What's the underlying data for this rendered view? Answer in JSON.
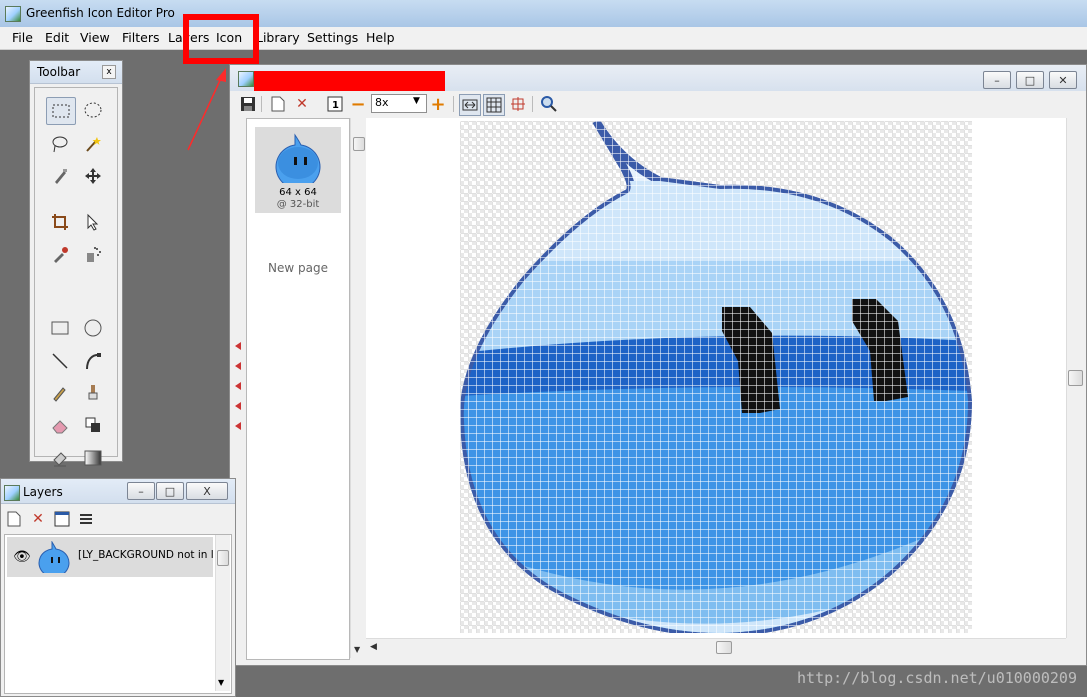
{
  "window": {
    "title": "Greenfish Icon Editor Pro"
  },
  "menu": [
    "File",
    "Edit",
    "View",
    "Filters",
    "Layers",
    "Icon",
    "Library",
    "Settings",
    "Help"
  ],
  "toolbar_panel": {
    "title": "Toolbar",
    "close": "x",
    "tools": [
      "rect-select",
      "ellipse-select",
      "lasso",
      "magic-wand",
      "picker-pen",
      "move",
      "crop",
      "pointer",
      "eyedropper",
      "spray",
      "rectangle",
      "ellipse",
      "line",
      "curve",
      "pencil",
      "brush",
      "eraser",
      "clone",
      "stamp",
      "gradient"
    ]
  },
  "layers_panel": {
    "title": "Layers",
    "minimize": "–",
    "maximize": "□",
    "close": "X",
    "layer_name": "[LY_BACKGROUND not in lar"
  },
  "document": {
    "zoom": "8x",
    "zoom_options": [
      "8x"
    ],
    "page_thumb": {
      "size": "64 x 64",
      "depth": "@ 32-bit"
    },
    "new_page": "New page"
  },
  "annotation": {
    "highlight_color": "#ff0000",
    "arrow_color": "#ff2a2a"
  },
  "watermark": "http://blog.csdn.net/u010000209",
  "colors": {
    "water_dark": "#1e63c6",
    "water_mid": "#3d94e6",
    "water_light": "#a9d3f6",
    "outline": "#3b5ba8"
  }
}
